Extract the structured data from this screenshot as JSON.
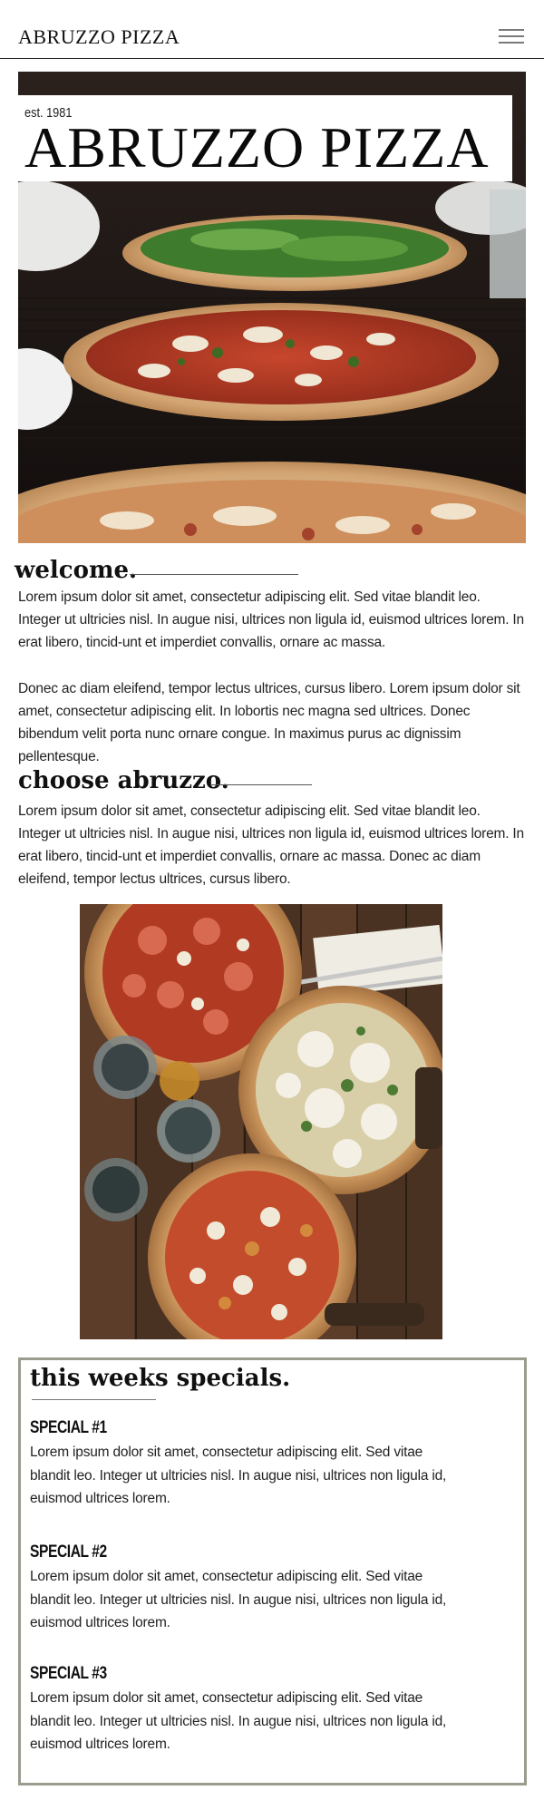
{
  "header": {
    "brand": "ABRUZZO PIZZA",
    "menu_icon": "hamburger-menu-icon"
  },
  "hero": {
    "est": "est. 1981",
    "title": "ABRUZZO PIZZA",
    "image": "pizzas-on-table-photo"
  },
  "welcome": {
    "heading": "welcome.",
    "paragraph1": "Lorem ipsum dolor sit amet, consectetur adipiscing elit. Sed vitae blandit leo. Integer ut ultricies nisl. In augue nisi, ultrices non ligula id, euismod ultrices lorem. In erat libero, tincid-unt et imperdiet convallis, ornare ac massa.",
    "paragraph2": "Donec ac diam eleifend, tempor lectus ultrices, cursus libero. Lorem ipsum dolor sit amet, consectetur adipiscing elit. In lobortis nec magna sed ultrices. Donec bibendum velit porta nunc ornare congue. In maximus purus ac dignissim pellentesque."
  },
  "choose": {
    "heading": "choose abruzzo.",
    "paragraph": "Lorem ipsum dolor sit amet, consectetur adipiscing elit. Sed vitae blandit leo. Integer ut ultricies nisl. In augue nisi, ultrices non ligula id, euismod ultrices lorem. In erat libero, tincid-unt et imperdiet convallis, ornare ac massa. Donec ac diam eleifend, tempor lectus ultrices, cursus libero.",
    "image": "pizzas-top-view-photo"
  },
  "specials": {
    "heading": "this weeks specials.",
    "items": [
      {
        "title": "SPECIAL #1",
        "description": "Lorem ipsum dolor sit amet, consectetur adipiscing elit. Sed vitae blandit leo. Integer ut ultricies nisl. In augue nisi, ultrices non ligula id, euismod ultrices lorem."
      },
      {
        "title": "SPECIAL #2",
        "description": "Lorem ipsum dolor sit amet, consectetur adipiscing elit. Sed vitae blandit leo. Integer ut ultricies nisl. In augue nisi, ultrices non ligula id, euismod ultrices lorem."
      },
      {
        "title": "SPECIAL #3",
        "description": "Lorem ipsum dolor sit amet, consectetur adipiscing elit. Sed vitae blandit leo. Integer ut ultricies nisl. In augue nisi, ultrices non ligula id, euismod ultrices lorem."
      }
    ]
  },
  "colors": {
    "border": "#9b9b8e",
    "text": "#111111",
    "header_rule": "#222222"
  }
}
